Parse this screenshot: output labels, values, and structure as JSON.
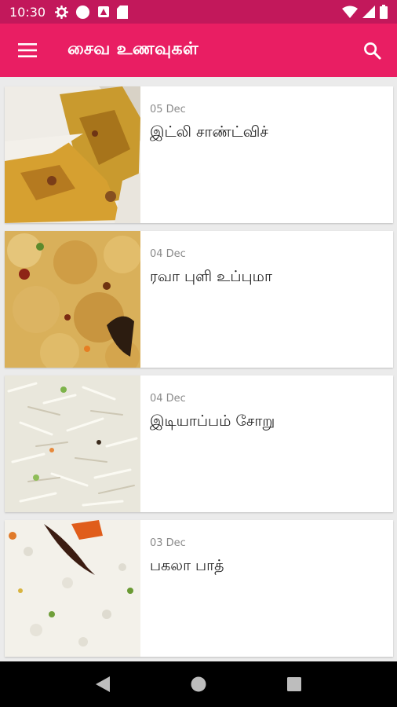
{
  "status_bar": {
    "time": "10:30"
  },
  "app_bar": {
    "title": "சைவ உணவுகள்"
  },
  "recipes": [
    {
      "date": "05 Dec",
      "title": "இட்லி சாண்ட்விச்"
    },
    {
      "date": "04 Dec",
      "title": "ரவா புளி உப்புமா"
    },
    {
      "date": "04 Dec",
      "title": "இடியாப்பம் சோறு"
    },
    {
      "date": "03 Dec",
      "title": "பகலா பாத்"
    }
  ],
  "colors": {
    "status_bar": "#c2185b",
    "app_bar": "#e91e63",
    "background": "#ebebeb"
  },
  "icons": {
    "status_left": [
      "settings-icon",
      "circle-icon",
      "sim-alert-icon",
      "sd-card-icon"
    ],
    "status_right": [
      "wifi-icon",
      "signal-icon",
      "battery-icon"
    ],
    "app_bar": [
      "menu-icon",
      "search-icon"
    ],
    "navigation": [
      "back-icon",
      "home-icon",
      "recents-icon"
    ]
  }
}
